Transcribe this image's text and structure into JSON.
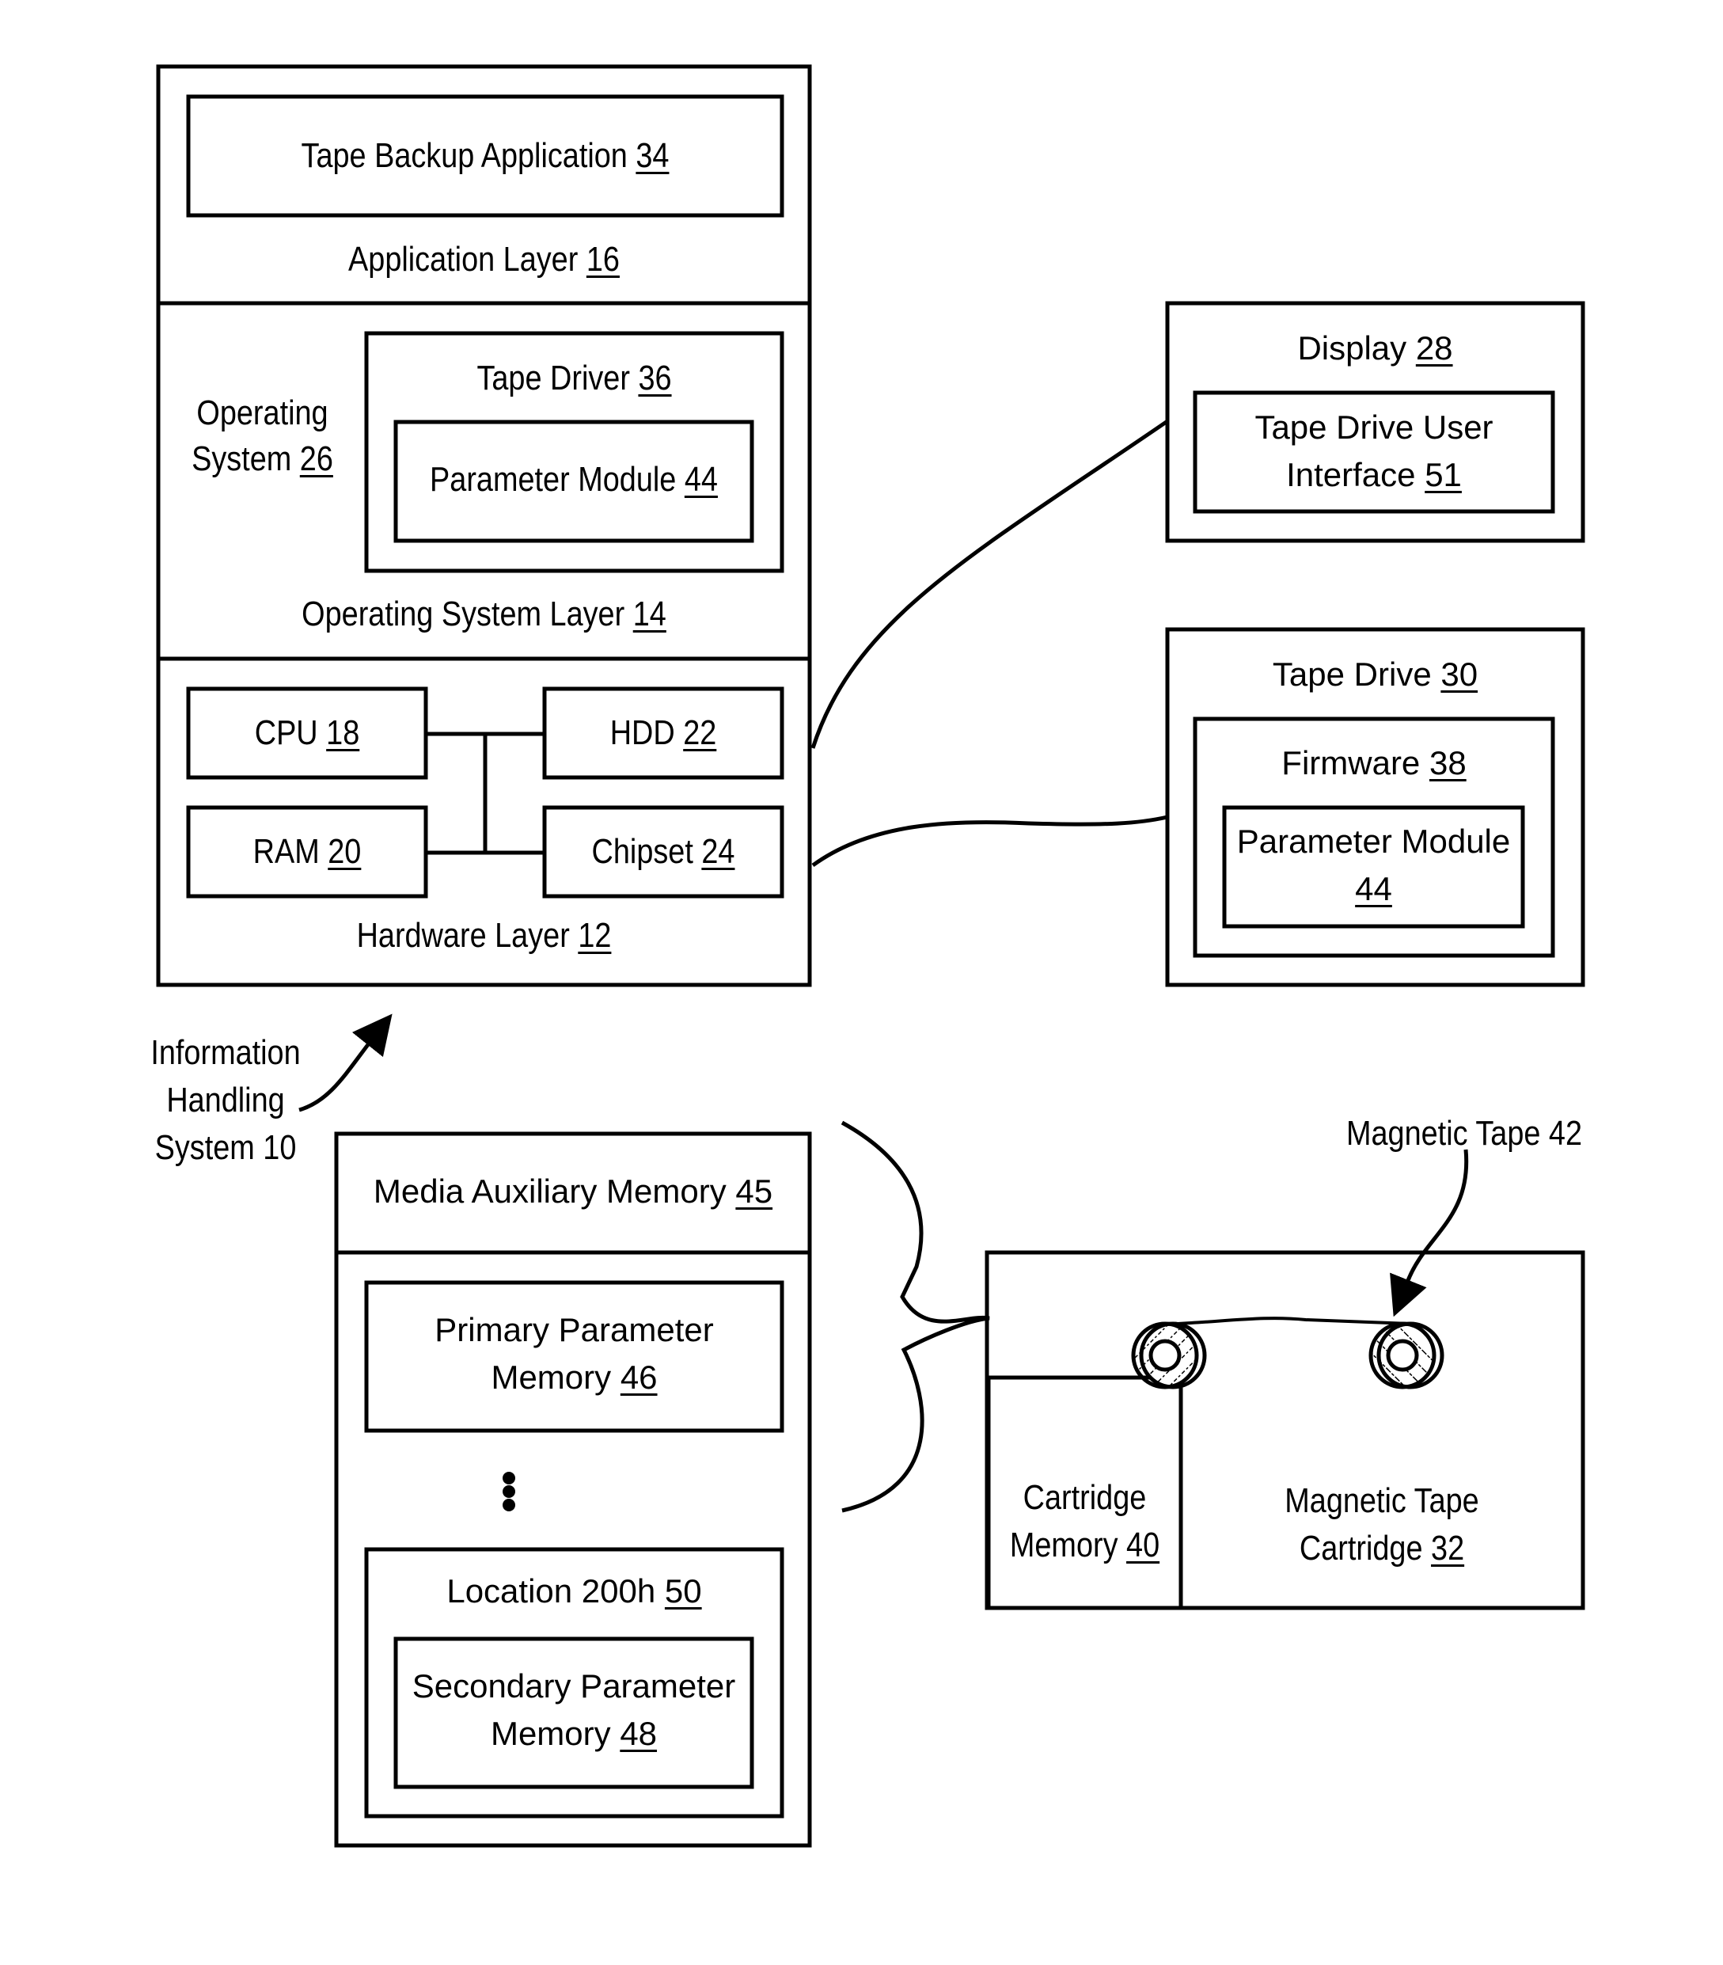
{
  "figure": {
    "application_layer": {
      "label": "Application Layer",
      "ref": "16",
      "tape_backup_app": {
        "label": "Tape Backup Application",
        "ref": "34"
      }
    },
    "os_layer": {
      "label": "Operating System Layer",
      "ref": "14",
      "operating_system": {
        "line1": "Operating",
        "line2": "System",
        "ref": "26"
      },
      "tape_driver": {
        "label": "Tape Driver",
        "ref": "36"
      },
      "parameter_module": {
        "label": "Parameter Module",
        "ref": "44"
      }
    },
    "hardware_layer": {
      "label": "Hardware Layer",
      "ref": "12",
      "cpu": {
        "label": "CPU",
        "ref": "18"
      },
      "hdd": {
        "label": "HDD",
        "ref": "22"
      },
      "ram": {
        "label": "RAM",
        "ref": "20"
      },
      "chipset": {
        "label": "Chipset",
        "ref": "24"
      }
    },
    "display": {
      "label": "Display",
      "ref": "28",
      "tape_drive_ui": {
        "line1": "Tape Drive User",
        "line2": "Interface",
        "ref": "51"
      }
    },
    "tape_drive": {
      "label": "Tape Drive",
      "ref": "30",
      "firmware": {
        "label": "Firmware",
        "ref": "38"
      },
      "parameter_module": {
        "line1": "Parameter Module",
        "ref": "44"
      }
    },
    "information_handling_system": {
      "line1": "Information",
      "line2": "Handling",
      "line3": "System 10"
    },
    "media_aux_memory": {
      "label": "Media Auxiliary Memory",
      "ref": "45",
      "primary_param_memory": {
        "line1": "Primary Parameter",
        "line2": "Memory",
        "ref": "46"
      },
      "ellipsis": "⋮",
      "location": {
        "label": "Location 200h",
        "ref": "50"
      },
      "secondary_param_memory": {
        "line1": "Secondary Parameter",
        "line2": "Memory",
        "ref": "48"
      }
    },
    "magnetic_tape_label": "Magnetic Tape 42",
    "cartridge": {
      "line1": "Magnetic Tape",
      "line2": "Cartridge",
      "ref": "32",
      "cartridge_memory": {
        "line1": "Cartridge",
        "line2": "Memory",
        "ref": "40"
      }
    }
  }
}
